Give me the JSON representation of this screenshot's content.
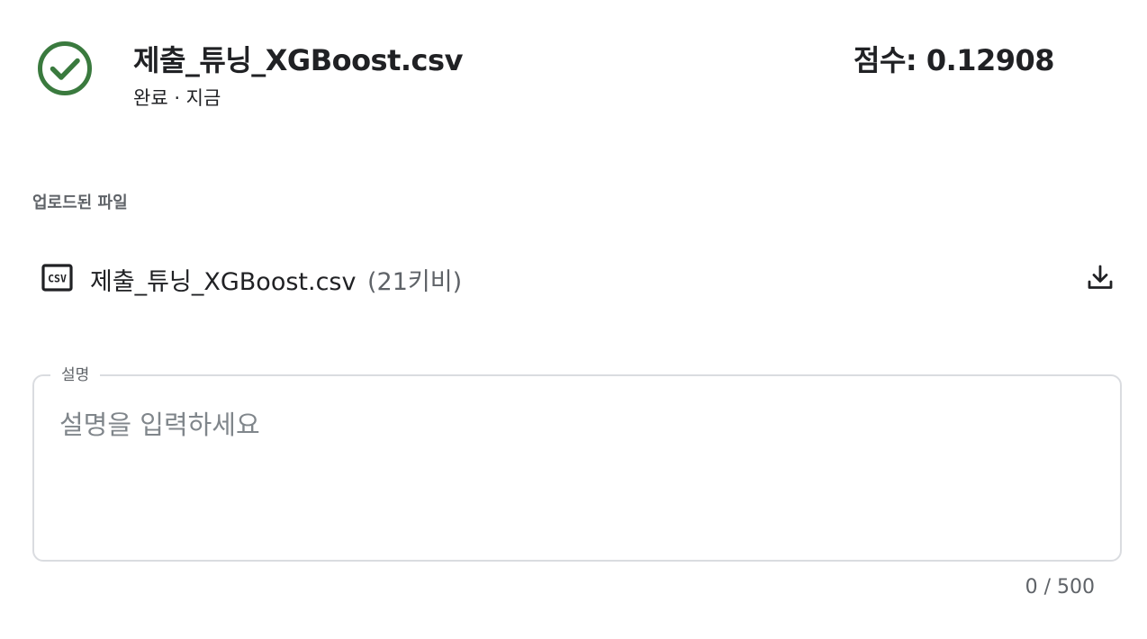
{
  "submission": {
    "title": "제출_튜닝_XGBoost.csv",
    "status_text": "완료 · 지금",
    "score_text": "점수: 0.12908",
    "status_color": "#3a7a3e"
  },
  "uploaded": {
    "section_label": "업로드된 파일",
    "file_icon": "csv-file-icon",
    "file_name": "제출_튜닝_XGBoost.csv",
    "file_size": "(21키비)",
    "download_icon": "download-icon"
  },
  "description": {
    "label": "설명",
    "placeholder": "설명을 입력하세요",
    "value": "",
    "counter": "0 / 500"
  }
}
